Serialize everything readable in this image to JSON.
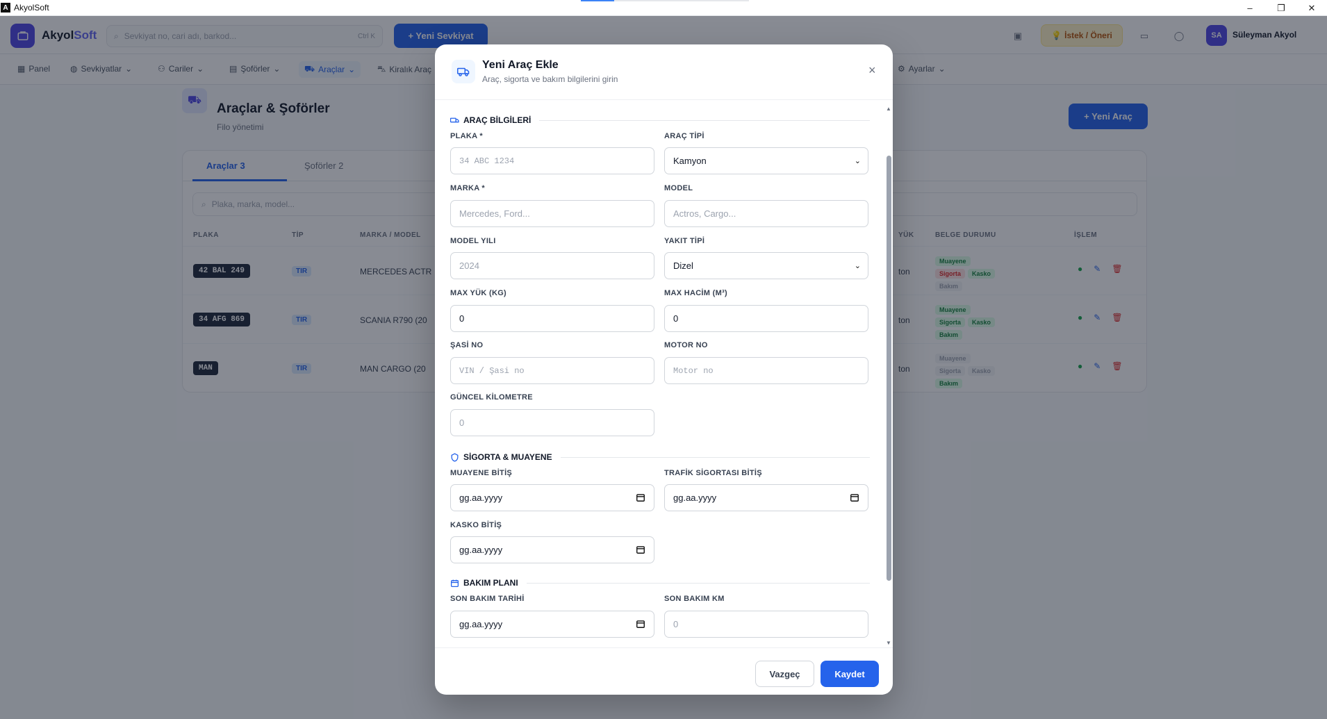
{
  "window": {
    "title": "AkyolSoft",
    "progress": 0.2,
    "minimize": "–",
    "maximize": "❐",
    "close": "✕"
  },
  "topbar": {
    "logo_main": "Akyol",
    "logo_accent": "Soft",
    "search_placeholder": "Sevkiyat no, cari adı, barkod...",
    "search_shortcut": "Ctrl K",
    "new_shipment": "+ Yeni Sevkiyat",
    "suggestion": "İstek / Öneri",
    "avatar": "SA",
    "user": "Süleyman Akyol"
  },
  "nav": [
    {
      "label": "Panel"
    },
    {
      "label": "Sevkiyatlar"
    },
    {
      "label": "Cariler"
    },
    {
      "label": "Şoförler"
    },
    {
      "label": "Araçlar"
    },
    {
      "label": "Kiralık Araç"
    },
    {
      "label": "Ayarlar"
    }
  ],
  "page": {
    "title": "Araçlar & Şoförler",
    "subtitle": "Filo yönetimi",
    "new_button": "+ Yeni Araç"
  },
  "tabs": [
    {
      "label": "Araçlar",
      "count": "3"
    },
    {
      "label": "Şoförler",
      "count": "2"
    }
  ],
  "list_search_placeholder": "Plaka, marka, model...",
  "table": {
    "headers": [
      "PLAKA",
      "TİP",
      "MARKA / MODEL",
      "YÜK",
      "BELGE DURUMU",
      "İŞLEM"
    ],
    "rows": [
      {
        "plate": "42 BAL 249",
        "type": "TIR",
        "brand": "MERCEDES ACTR",
        "load": "ton",
        "docs": [
          [
            "Muayene",
            "ok"
          ],
          [
            "Sigorta",
            "bad"
          ],
          [
            "Kasko",
            "ok"
          ],
          [
            "Bakım",
            "none"
          ]
        ]
      },
      {
        "plate": "34 AFG 869",
        "type": "TIR",
        "brand": "SCANIA R790 (20",
        "load": "ton",
        "docs": [
          [
            "Muayene",
            "ok"
          ],
          [
            "Sigorta",
            "ok"
          ],
          [
            "Kasko",
            "ok"
          ],
          [
            "Bakım",
            "ok"
          ]
        ]
      },
      {
        "plate": "MAN",
        "type": "TIR",
        "brand": "MAN CARGO (20",
        "load": "ton",
        "docs": [
          [
            "Muayene",
            "none"
          ],
          [
            "Sigorta",
            "none"
          ],
          [
            "Kasko",
            "none"
          ],
          [
            "Bakım",
            "ok"
          ]
        ]
      }
    ]
  },
  "modal": {
    "title": "Yeni Araç Ekle",
    "subtitle": "Araç, sigorta ve bakım bilgilerini girin",
    "close": "×",
    "sections": {
      "vehicle": "ARAÇ BİLGİLERİ",
      "insurance": "SİGORTA & MUAYENE",
      "maintenance": "BAKIM PLANI"
    },
    "fields": {
      "plate": {
        "label": "PLAKA *",
        "placeholder": "34 ABC 1234"
      },
      "vehicle_type": {
        "label": "ARAÇ TİPİ",
        "value": "Kamyon"
      },
      "brand": {
        "label": "MARKA *",
        "placeholder": "Mercedes, Ford..."
      },
      "model": {
        "label": "MODEL",
        "placeholder": "Actros, Cargo..."
      },
      "model_year": {
        "label": "MODEL YILI",
        "placeholder": "2024"
      },
      "fuel_type": {
        "label": "YAKIT TİPİ",
        "value": "Dizel"
      },
      "max_load": {
        "label": "MAX YÜK (KG)",
        "value": "0"
      },
      "max_volume": {
        "label": "MAX HACİM (M³)",
        "value": "0"
      },
      "chassis": {
        "label": "ŞASİ NO",
        "placeholder": "VIN / Şasi no"
      },
      "engine": {
        "label": "MOTOR NO",
        "placeholder": "Motor no"
      },
      "km": {
        "label": "GÜNCEL KİLOMETRE",
        "placeholder": "0"
      },
      "inspection_end": {
        "label": "MUAYENE BİTİŞ",
        "value": "gg.aa.yyyy"
      },
      "traffic_ins_end": {
        "label": "TRAFİK SİGORTASI BİTİŞ",
        "value": "gg.aa.yyyy"
      },
      "kasko_end": {
        "label": "KASKO BİTİŞ",
        "value": "gg.aa.yyyy"
      },
      "last_maint_date": {
        "label": "SON BAKIM TARİHİ",
        "value": "gg.aa.yyyy"
      },
      "last_maint_km": {
        "label": "SON BAKIM KM",
        "placeholder": "0"
      }
    },
    "cancel": "Vazgeç",
    "save": "Kaydet"
  }
}
